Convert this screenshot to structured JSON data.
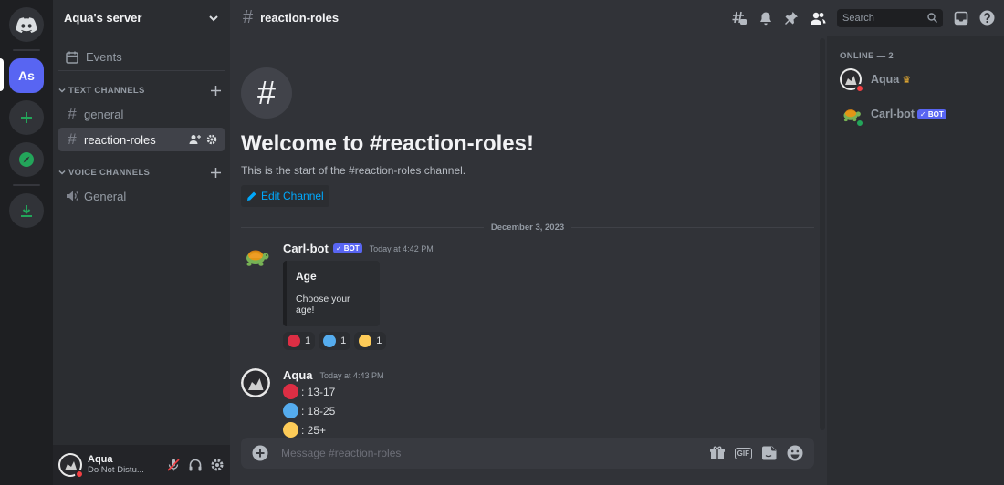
{
  "colors": {
    "accent": "#5865f2",
    "online": "#23a55a",
    "dnd": "#f23f43",
    "red": "#dd2e44",
    "blue": "#55acee",
    "yellow": "#fdcb58",
    "link": "#00a8fc"
  },
  "rail": {
    "server_initials": "As"
  },
  "server": {
    "name": "Aqua's server"
  },
  "sidebar": {
    "events_label": "Events",
    "text_category": "TEXT CHANNELS",
    "voice_category": "VOICE CHANNELS",
    "text_channels": [
      {
        "label": "general"
      },
      {
        "label": "reaction-roles"
      }
    ],
    "voice_channels": [
      {
        "label": "General"
      }
    ]
  },
  "user_panel": {
    "name": "Aqua",
    "status": "Do Not Distu..."
  },
  "topbar": {
    "channel": "reaction-roles",
    "search_placeholder": "Search"
  },
  "welcome": {
    "title": "Welcome to #reaction-roles!",
    "subtitle": "This is the start of the #reaction-roles channel.",
    "edit_label": "Edit Channel"
  },
  "divider_date": "December 3, 2023",
  "messages": [
    {
      "author": "Carl-bot",
      "bot_tag": "✓ BOT",
      "time": "Today at 4:42 PM",
      "embed": {
        "title": "Age",
        "description": "Choose your age!"
      },
      "reactions": [
        {
          "color": "red",
          "count": "1"
        },
        {
          "color": "blue",
          "count": "1"
        },
        {
          "color": "yellow",
          "count": "1"
        }
      ]
    },
    {
      "author": "Aqua",
      "time": "Today at 4:43 PM",
      "lines": [
        {
          "color": "red",
          "text": ": 13-17"
        },
        {
          "color": "blue",
          "text": ": 18-25"
        },
        {
          "color": "yellow",
          "text": ": 25+"
        }
      ]
    }
  ],
  "composer": {
    "placeholder": "Message #reaction-roles",
    "gif_label": "GIF"
  },
  "members": {
    "header": "ONLINE — 2",
    "list": [
      {
        "name": "Aqua",
        "status": "dnd"
      },
      {
        "name": "Carl-bot",
        "status": "online",
        "bot_tag": "✓ BOT"
      }
    ]
  }
}
